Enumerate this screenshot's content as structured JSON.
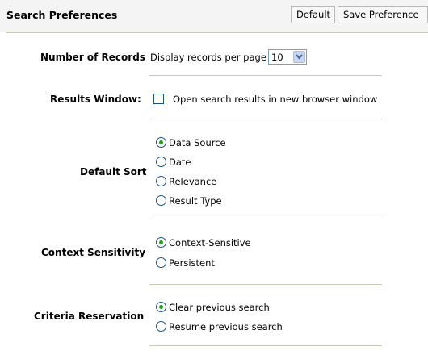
{
  "header": {
    "title": "Search Preferences",
    "default_button": "Default",
    "save_button": "Save Preference"
  },
  "records": {
    "label": "Number of Records",
    "text": "Display records per page",
    "selected_value": "10"
  },
  "results_window": {
    "label": "Results Window:",
    "checkbox_label": "Open search results in new browser window",
    "checked": false
  },
  "default_sort": {
    "label": "Default Sort",
    "options": [
      "Data Source",
      "Date",
      "Relevance",
      "Result Type"
    ],
    "selected": "Data Source"
  },
  "context_sensitivity": {
    "label": "Context Sensitivity",
    "options": [
      "Context-Sensitive",
      "Persistent"
    ],
    "selected": "Context-Sensitive"
  },
  "criteria_reservation": {
    "label": "Criteria Reservation",
    "options": [
      "Clear previous search",
      "Resume previous search"
    ],
    "selected": "Clear previous search"
  },
  "colors": {
    "radio_selected": "#21a121",
    "separator": "#c8c8b4"
  }
}
